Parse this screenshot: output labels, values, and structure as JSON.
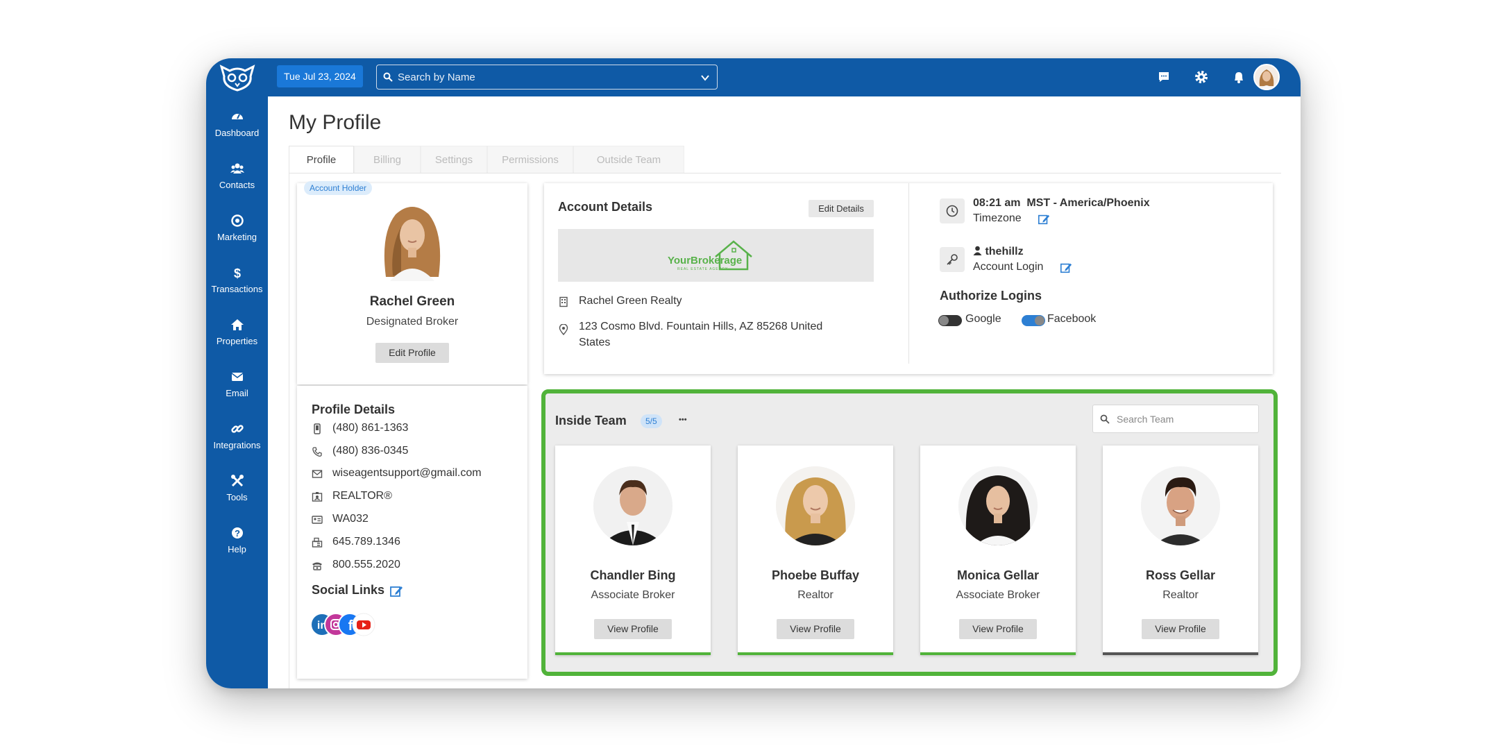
{
  "topbar": {
    "date": "Tue Jul 23, 2024",
    "search_placeholder": "Search by Name"
  },
  "sidebar": {
    "items": [
      {
        "label": "Dashboard",
        "icon": "dashboard-icon"
      },
      {
        "label": "Contacts",
        "icon": "contacts-icon"
      },
      {
        "label": "Marketing",
        "icon": "marketing-icon"
      },
      {
        "label": "Transactions",
        "icon": "dollar-icon"
      },
      {
        "label": "Properties",
        "icon": "home-icon"
      },
      {
        "label": "Email",
        "icon": "envelope-icon"
      },
      {
        "label": "Integrations",
        "icon": "link-icon"
      },
      {
        "label": "Tools",
        "icon": "tools-icon"
      },
      {
        "label": "Help",
        "icon": "help-icon"
      }
    ]
  },
  "page": {
    "title": "My Profile",
    "tabs": [
      "Profile",
      "Billing",
      "Settings",
      "Permissions",
      "Outside Team"
    ]
  },
  "profile": {
    "badge": "Account Holder",
    "name": "Rachel Green",
    "role": "Designated Broker",
    "edit_label": "Edit Profile"
  },
  "profile_details": {
    "heading": "Profile Details",
    "rows": [
      "(480) 861-1363",
      "(480) 836-0345",
      "wiseagentsupport@gmail.com",
      "REALTOR®",
      "WA032",
      "645.789.1346",
      "800.555.2020"
    ],
    "social_heading": "Social Links"
  },
  "account": {
    "heading": "Account Details",
    "edit_label": "Edit Details",
    "brand_name": "YourBrokerage",
    "brand_tagline": "REAL ESTATE AGENCY",
    "company": "Rachel Green Realty",
    "address": "123 Cosmo Blvd. Fountain Hills, AZ 85268 United States",
    "time": "08:21 am",
    "timezone_name": "MST - America/Phoenix",
    "timezone_label": "Timezone",
    "username": "thehillz",
    "login_label": "Account Login",
    "authorize_heading": "Authorize Logins",
    "google_label": "Google",
    "facebook_label": "Facebook"
  },
  "team": {
    "heading": "Inside Team",
    "count": "5/5",
    "more": "•••",
    "search_placeholder": "Search Team",
    "members": [
      {
        "name": "Chandler Bing",
        "role": "Associate Broker",
        "button": "View Profile"
      },
      {
        "name": "Phoebe Buffay",
        "role": "Realtor",
        "button": "View Profile"
      },
      {
        "name": "Monica Gellar",
        "role": "Associate Broker",
        "button": "View Profile"
      },
      {
        "name": "Ross Gellar",
        "role": "Realtor",
        "button": "View Profile"
      }
    ]
  },
  "colors": {
    "brand_blue": "#0f5aa6",
    "accent_green": "#51b33a",
    "link_blue": "#2d7fd3"
  }
}
